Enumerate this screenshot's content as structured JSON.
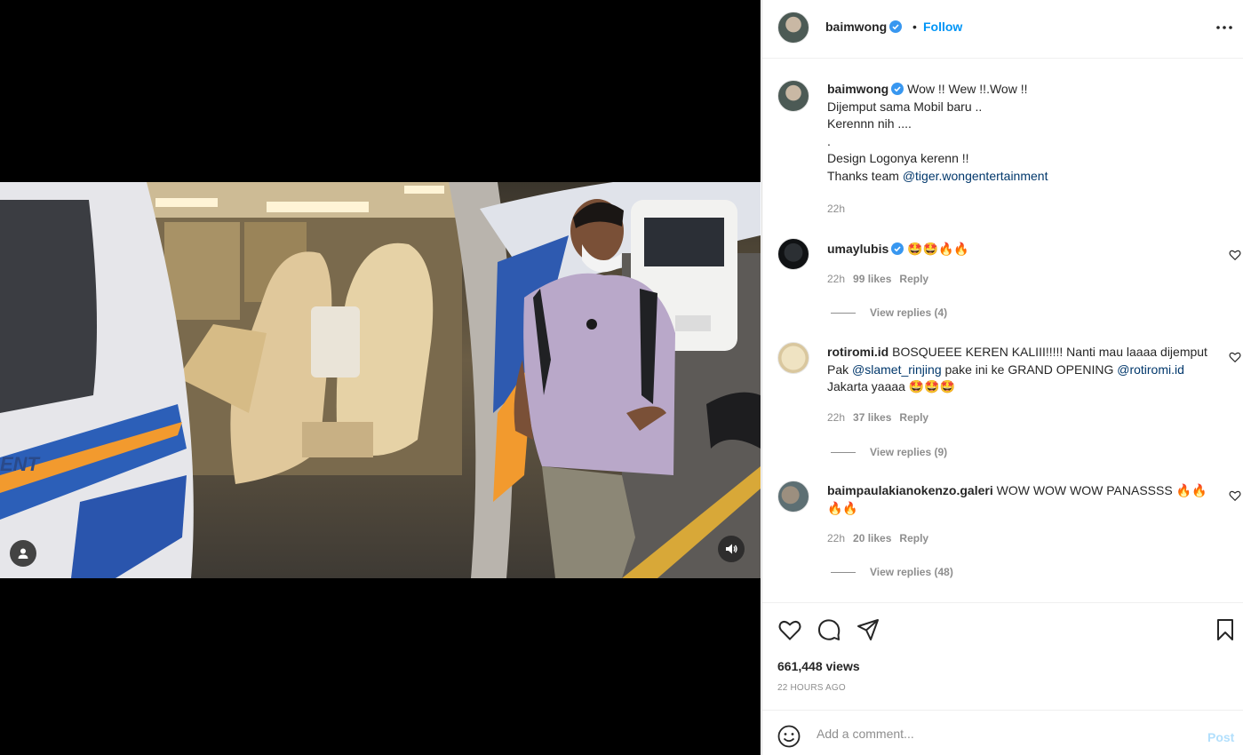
{
  "header": {
    "username": "baimwong",
    "separator": "•",
    "follow_label": "Follow"
  },
  "caption": {
    "username": "baimwong",
    "lines": [
      "Wow !! Wew !!.Wow !!",
      "Dijemput sama Mobil baru ..",
      "Kerennn nih ....",
      ".",
      "Design Logonya kerenn !!"
    ],
    "thanks_prefix": "Thanks team ",
    "mention": "@tiger.wongentertainment",
    "time": "22h"
  },
  "comments": [
    {
      "username": "umaylubis",
      "verified": true,
      "text": "🤩🤩🔥🔥",
      "time": "22h",
      "likes": "99 likes",
      "reply": "Reply",
      "view_replies": "View replies (4)"
    },
    {
      "username": "rotiromi.id",
      "verified": false,
      "text_1": "BOSQUEEE KEREN KALIII!!!!! Nanti mau laaaa dijemput Pak ",
      "mention_1": "@slamet_rinjing",
      "text_2": " pake ini ke GRAND OPENING ",
      "mention_2": "@rotiromi.id",
      "text_3": " Jakarta yaaaa 🤩🤩🤩",
      "time": "22h",
      "likes": "37 likes",
      "reply": "Reply",
      "view_replies": "View replies (9)"
    },
    {
      "username": "baimpaulakianokenzo.galeri",
      "verified": false,
      "text": "WOW WOW WOW PANASSSS 🔥🔥🔥🔥",
      "time": "22h",
      "likes": "20 likes",
      "reply": "Reply",
      "view_replies": "View replies (48)"
    }
  ],
  "stats": {
    "views": "661,448 views",
    "posted": "22 HOURS AGO"
  },
  "composer": {
    "placeholder": "Add a comment...",
    "post_label": "Post"
  },
  "colors": {
    "accent": "#0095f6",
    "link": "#00376b",
    "muted": "#8e8e8e",
    "verified": "#3897f0"
  },
  "icons": [
    "user-tag-icon",
    "volume-icon",
    "more-options-icon",
    "verified-badge-icon",
    "heart-icon",
    "comment-icon",
    "share-icon",
    "bookmark-icon",
    "emoji-icon"
  ]
}
